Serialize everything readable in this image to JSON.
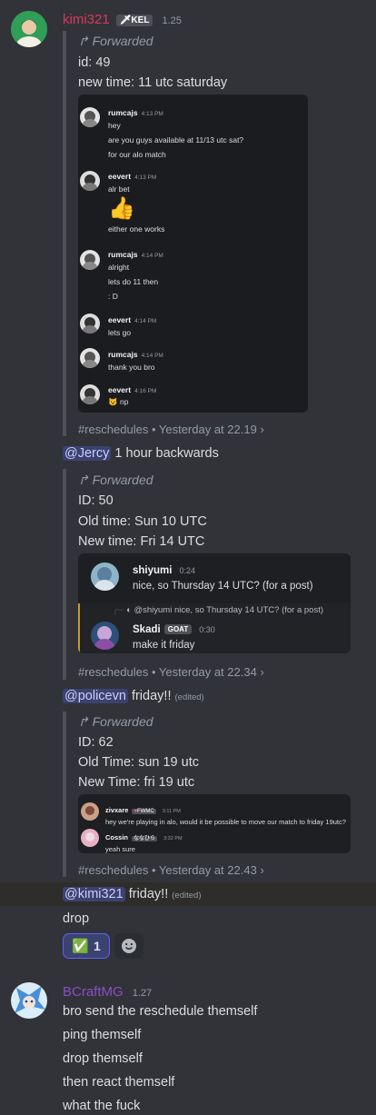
{
  "msg1": {
    "username": "kimi321",
    "tag": "KEL",
    "timestamp": "1.25",
    "forward1": {
      "label": "Forwarded",
      "lines": [
        "id: 49",
        "new time: 11 utc saturday"
      ],
      "chat": [
        {
          "user": "rumcajs",
          "time": "4:13 PM",
          "lines": [
            "hey",
            "are you guys available at 11/13 utc sat?",
            "for our alo match"
          ]
        },
        {
          "user": "eevert",
          "time": "4:13 PM",
          "lines": [
            "alr bet"
          ],
          "emoji": "👍",
          "after": "either one works"
        },
        {
          "user": "rumcajs",
          "time": "4:14 PM",
          "lines": [
            "alright",
            "lets do 11 then",
            ": D"
          ]
        },
        {
          "user": "eevert",
          "time": "4:14 PM",
          "lines": [
            "lets go"
          ]
        },
        {
          "user": "rumcajs",
          "time": "4:14 PM",
          "lines": [
            "thank you bro"
          ]
        },
        {
          "user": "eevert",
          "time": "4:16 PM",
          "emoji_inline": "😾",
          "lines": [
            "np"
          ]
        }
      ],
      "meta_channel": "#reschedules",
      "meta_time": "Yesterday at 22.19"
    },
    "reply1": {
      "mention": "@Jercy",
      "text": "1 hour backwards"
    },
    "forward2": {
      "label": "Forwarded",
      "lines": [
        "ID: 50",
        "Old time: Sun 10 UTC",
        "New time: Fri 14 UTC"
      ],
      "embed": {
        "m1": {
          "user": "shiyumi",
          "time": "0:24",
          "text": "nice, so Thursday 14 UTC? (for a post)"
        },
        "reply_ref": {
          "user": "@shiyumi",
          "text": "nice, so Thursday 14 UTC? (for a post)"
        },
        "m2": {
          "user": "Skadi",
          "tag": "GOAT",
          "time": "0:30",
          "text": "make it friday"
        }
      },
      "meta_channel": "#reschedules",
      "meta_time": "Yesterday at 22.34"
    },
    "reply2": {
      "mention": "@policevn",
      "text": "friday!!",
      "edited": "(edited)"
    },
    "forward3": {
      "label": "Forwarded",
      "lines": [
        "ID: 62",
        "Old Time: sun 19 utc",
        "New Time: fri 19 utc"
      ],
      "embed": {
        "m1": {
          "user": "zivxare",
          "tag": "FWMC",
          "time": "3:11 PM",
          "text": "hey we're playing in alo, would it be possible to move our match to friday 19utc?"
        },
        "m2": {
          "user": "Cossin",
          "tag": "ななひら",
          "time": "3:32 PM",
          "text": "yeah sure"
        }
      },
      "meta_channel": "#reschedules",
      "meta_time": "Yesterday at 22.43"
    },
    "reply3": {
      "mention": "@kimi321",
      "text": "friday!!",
      "edited": "(edited)"
    },
    "drop": "drop",
    "reaction": {
      "emoji": "✅",
      "count": "1"
    }
  },
  "msg2": {
    "username": "BCraftMG",
    "timestamp": "1.27",
    "lines": [
      "bro send the reschedule themself",
      "ping themself",
      "drop themself",
      "then react themself",
      "what the fuck"
    ]
  },
  "colors": {
    "kimi": "#d6395c",
    "bcraft": "#8e4cc9",
    "mention_bg": "#3c4270",
    "check": "#43a25a"
  }
}
